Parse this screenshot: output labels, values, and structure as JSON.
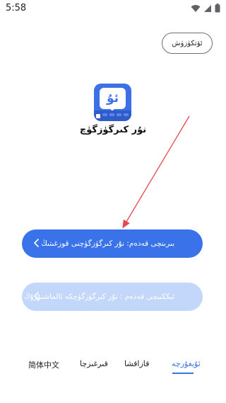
{
  "status_bar": {
    "time": "5:58"
  },
  "skip_button": {
    "label": "ئۆتكۈزۈش"
  },
  "app": {
    "name": "نۇر كىرگۈزگۈچ",
    "icon_glyph": "ئۇ"
  },
  "steps": [
    {
      "label": "بىرىنچى قەدەم: نۇر كىرگۈزگۈچنى قوزغىتىڭ",
      "state": "active"
    },
    {
      "label": "ئىككىنچى قەدەم : نۇر كىرگۈزگۈچكە ئالماشتۇرۇڭ",
      "state": "disabled"
    }
  ],
  "language_tabs": [
    {
      "label": "简体中文",
      "active": false
    },
    {
      "label": "قىرغىزچا",
      "active": false
    },
    {
      "label": "قازاقشا",
      "active": false
    },
    {
      "label": "ئۇيغۇرچە",
      "active": true
    }
  ],
  "colors": {
    "accent": "#3a72ea",
    "disabled": "#c3d7fb",
    "arrow": "#e5484d"
  }
}
